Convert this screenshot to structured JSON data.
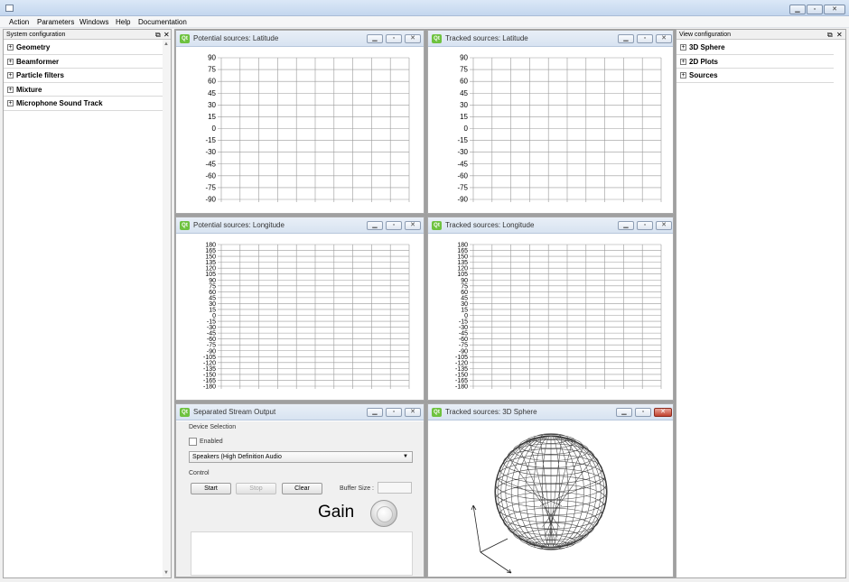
{
  "menu": [
    "Action",
    "Parameters",
    "Windows",
    "Help",
    "Documentation"
  ],
  "left_dock": {
    "title": "System configuration",
    "items": [
      "Geometry",
      "Beamformer",
      "Particle filters",
      "Mixture",
      "Microphone Sound Track"
    ]
  },
  "right_dock": {
    "title": "View configuration",
    "items": [
      "3D Sphere",
      "2D Plots",
      "Sources"
    ]
  },
  "windows": {
    "pot_lat": {
      "title": "Potential sources: Latitude"
    },
    "trk_lat": {
      "title": "Tracked sources: Latitude"
    },
    "pot_lon": {
      "title": "Potential sources: Longitude"
    },
    "trk_lon": {
      "title": "Tracked sources: Longitude"
    },
    "stream": {
      "title": "Separated Stream Output"
    },
    "sphere": {
      "title": "Tracked sources: 3D Sphere"
    }
  },
  "latitude_ticks": [
    "90",
    "75",
    "60",
    "45",
    "30",
    "15",
    "0",
    "-15",
    "-30",
    "-45",
    "-60",
    "-75",
    "-90"
  ],
  "longitude_ticks": [
    "180",
    "165",
    "150",
    "135",
    "120",
    "105",
    "90",
    "75",
    "60",
    "45",
    "30",
    "15",
    "0",
    "-15",
    "-30",
    "-45",
    "-60",
    "-75",
    "-90",
    "-105",
    "-120",
    "-135",
    "-150",
    "-165",
    "-180"
  ],
  "stream": {
    "device_selection_label": "Device Selection",
    "enabled_label": "Enabled",
    "device_value": "Speakers (High Definition Audio",
    "control_label": "Control",
    "start_label": "Start",
    "stop_label": "Stop",
    "clear_label": "Clear",
    "buffer_size_label": "Buffer Size :",
    "gain_label": "Gain"
  },
  "qt_icon_text": "Qt",
  "colors": {
    "qt_green": "#6ec23f",
    "grid": "#9a9a9a",
    "close_red": "#c2422e"
  }
}
